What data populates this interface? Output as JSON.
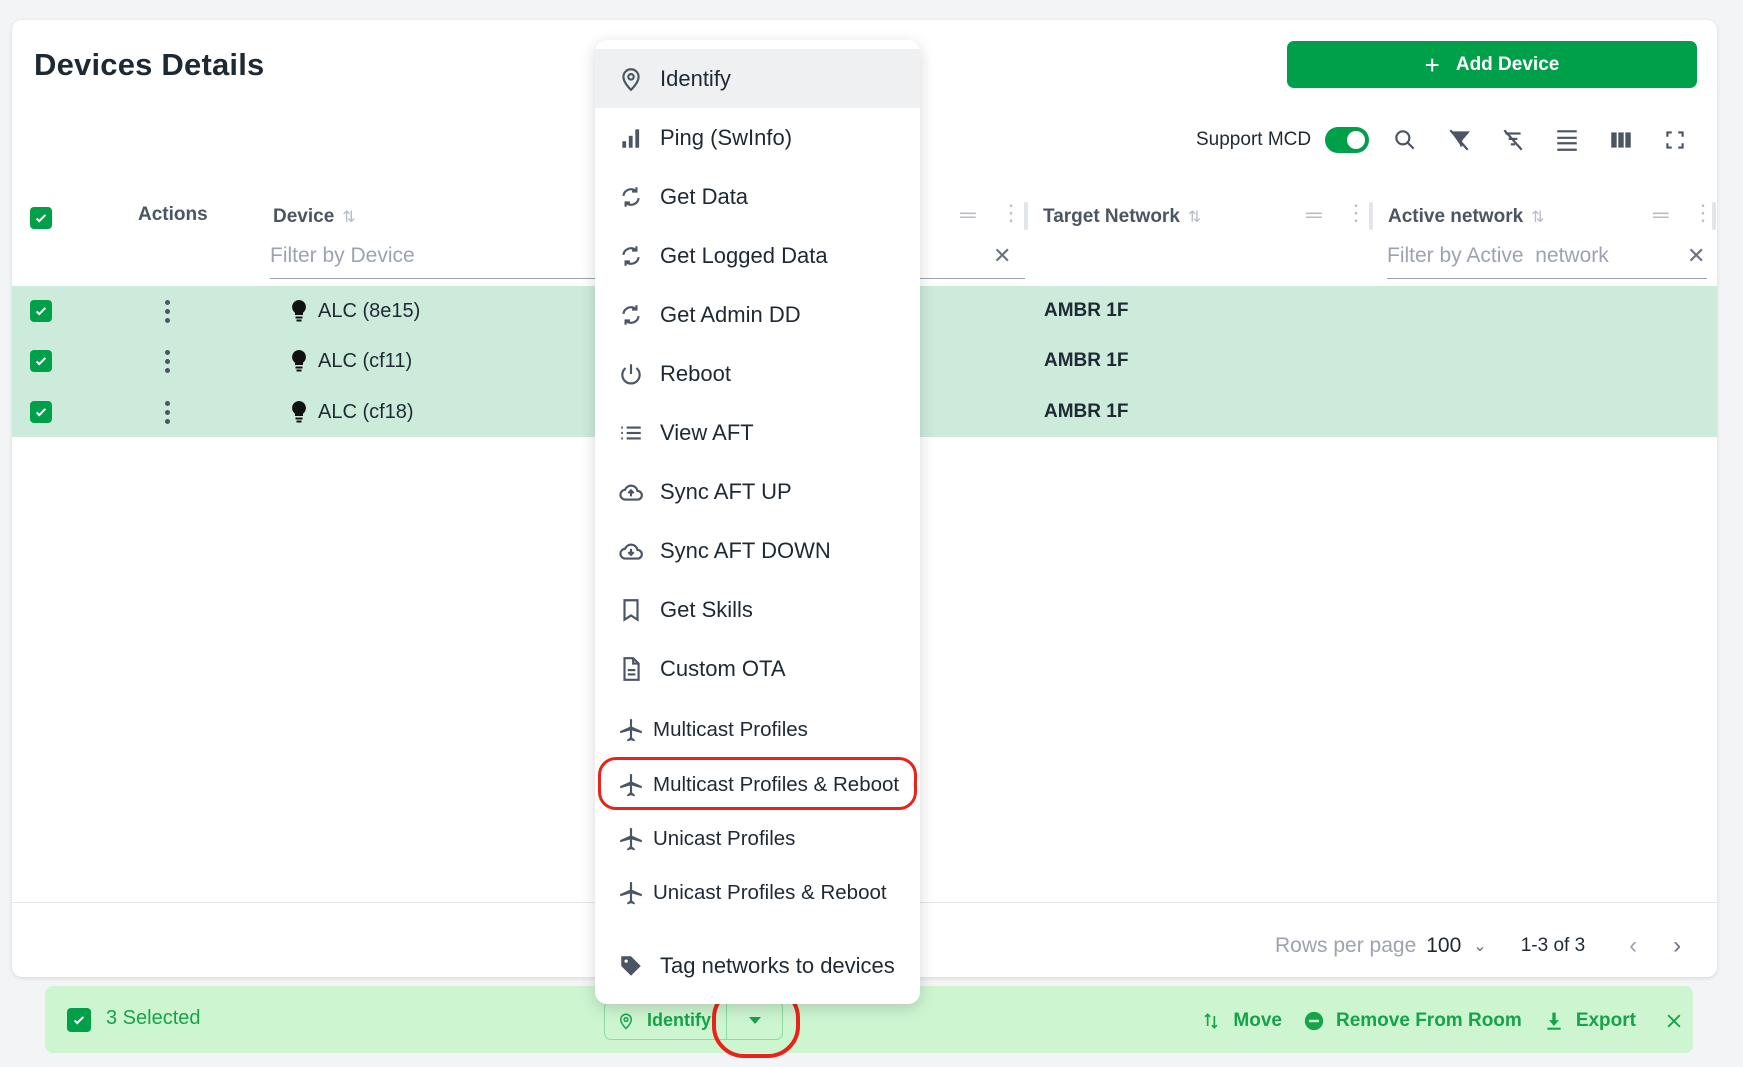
{
  "page": {
    "title": "Devices Details",
    "add_button_label": "Add Device"
  },
  "toolbar": {
    "support_mcd_label": "Support MCD",
    "support_mcd_enabled": true,
    "icons": [
      "search-icon",
      "filter-off-icon",
      "filter-list-off-icon",
      "density-icon",
      "columns-icon",
      "fullscreen-icon"
    ]
  },
  "table": {
    "columns": [
      {
        "label": "Actions"
      },
      {
        "label": "Device",
        "filter_placeholder": "Filter by Device"
      },
      {
        "label": "Target Network"
      },
      {
        "label": "Active network",
        "filter_placeholder": "Filter by Active  network"
      }
    ],
    "rows": [
      {
        "selected": true,
        "device": "ALC (8e15)",
        "target_network": "AMBR 1F",
        "active_network": ""
      },
      {
        "selected": true,
        "device": "ALC (cf11)",
        "target_network": "AMBR 1F",
        "active_network": ""
      },
      {
        "selected": true,
        "device": "ALC (cf18)",
        "target_network": "AMBR 1F",
        "active_network": ""
      }
    ],
    "pagination": {
      "rows_per_page_label": "Rows per page",
      "rows_per_page": "100",
      "range": "1-3 of 3"
    }
  },
  "menu": {
    "items": [
      {
        "label": "Identify",
        "icon": "location-pin-icon",
        "active": true
      },
      {
        "label": "Ping (SwInfo)",
        "icon": "signal-bars-icon"
      },
      {
        "label": "Get Data",
        "icon": "sync-icon"
      },
      {
        "label": "Get Logged Data",
        "icon": "sync-icon"
      },
      {
        "label": "Get Admin DD",
        "icon": "sync-icon"
      },
      {
        "label": "Reboot",
        "icon": "power-icon"
      },
      {
        "label": "View AFT",
        "icon": "list-icon"
      },
      {
        "label": "Sync AFT UP",
        "icon": "cloud-upload-icon"
      },
      {
        "label": "Sync AFT DOWN",
        "icon": "cloud-download-icon"
      },
      {
        "label": "Get Skills",
        "icon": "bookmark-icon"
      },
      {
        "label": "Custom OTA",
        "icon": "document-icon"
      },
      {
        "label": "Multicast Profiles",
        "icon": "airplane-icon"
      },
      {
        "label": "Multicast Profiles & Reboot",
        "icon": "airplane-icon",
        "highlighted": true
      },
      {
        "label": "Unicast Profiles",
        "icon": "airplane-icon"
      },
      {
        "label": "Unicast Profiles & Reboot",
        "icon": "airplane-icon"
      },
      {
        "label": "Tag networks to devices",
        "icon": "tag-icon"
      }
    ]
  },
  "selection_bar": {
    "count_label": "3 Selected",
    "split_button_label": "Identify",
    "actions": [
      {
        "label": "Move",
        "icon": "move-icon"
      },
      {
        "label": "Remove From Room",
        "icon": "remove-circle-icon"
      },
      {
        "label": "Export",
        "icon": "download-icon"
      }
    ]
  },
  "colors": {
    "brand_green": "#00a04a",
    "selected_row": "#cdebdb",
    "selection_bar": "#ccf5d0",
    "annotation_red": "#e8231a"
  }
}
